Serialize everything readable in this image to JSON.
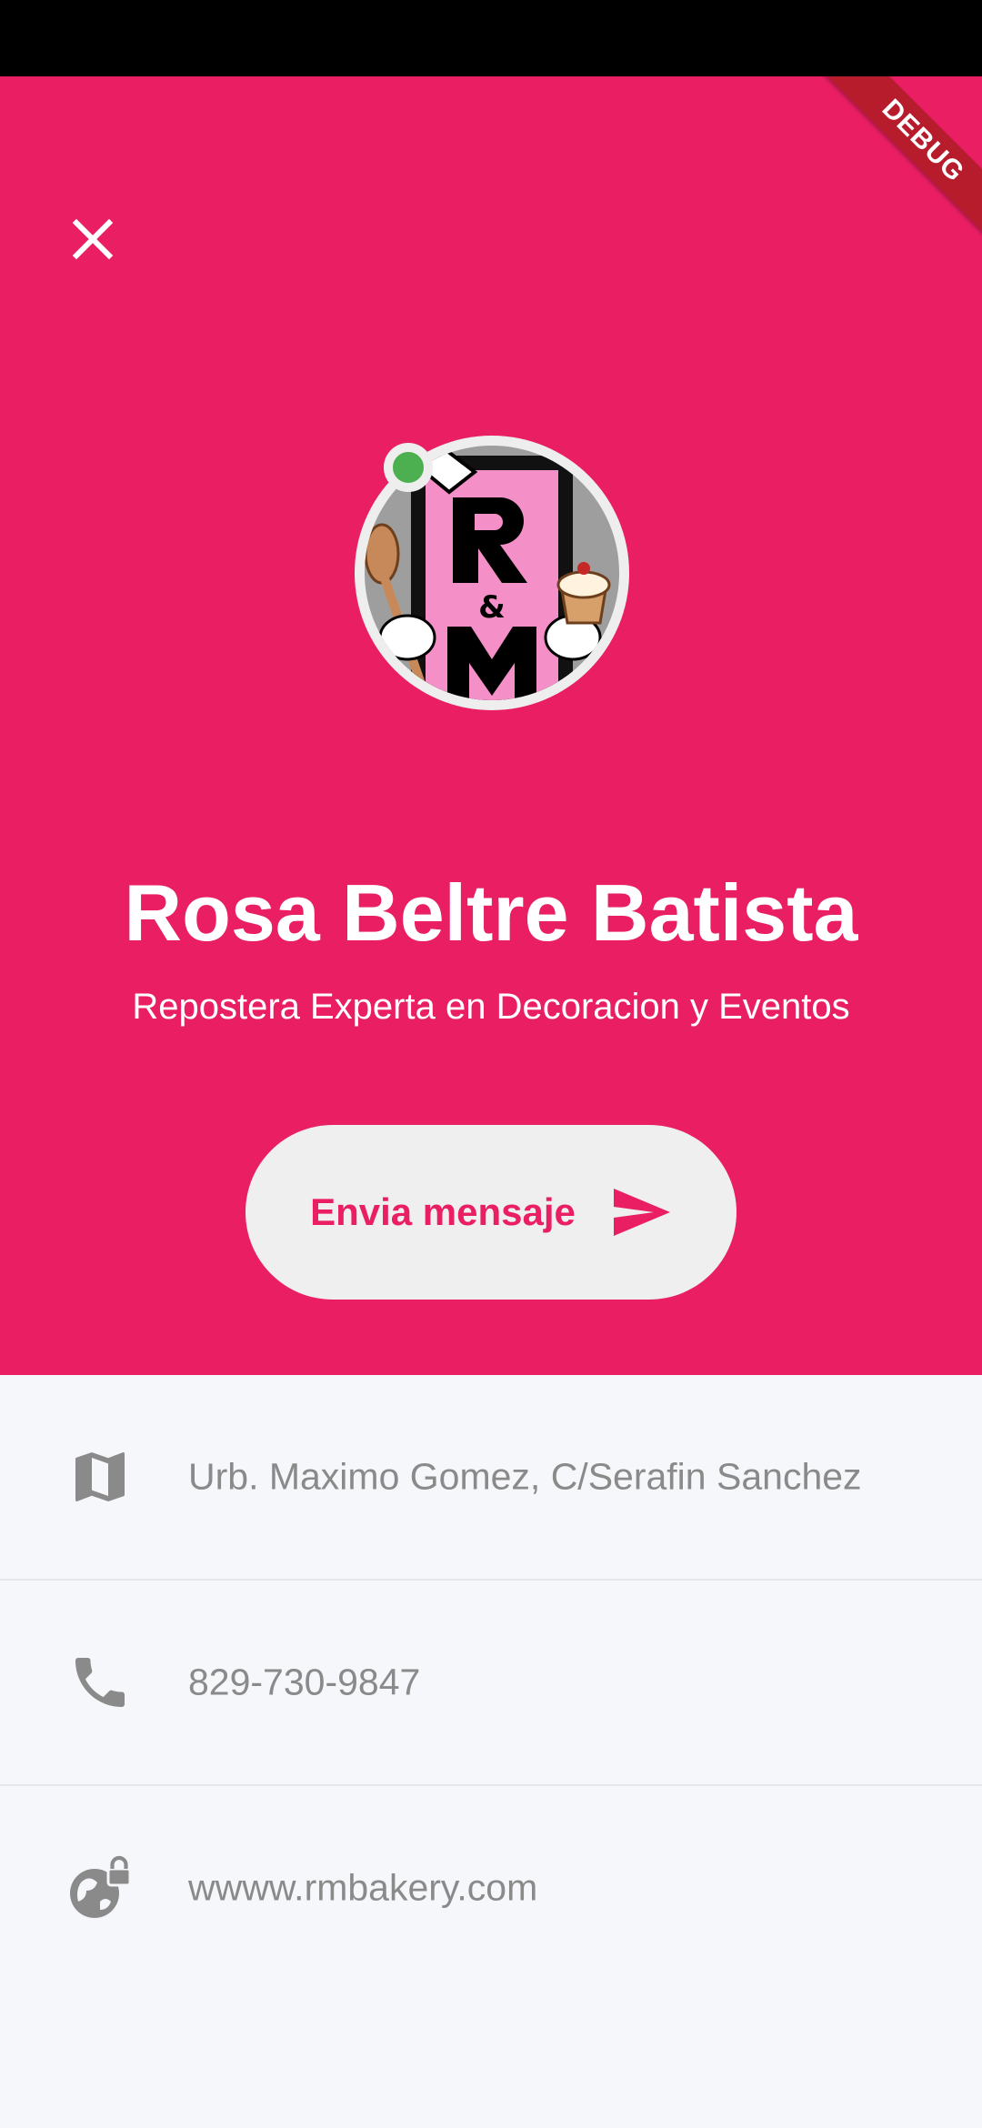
{
  "status_bar": {},
  "debug_banner": {
    "label": "DEBUG"
  },
  "profile": {
    "name": "Rosa Beltre Batista",
    "title": "Repostera Experta en Decoracion y Eventos",
    "avatar_icon": "rm-bakery-logo",
    "online_color": "#4caf50"
  },
  "actions": {
    "message_label": "Envia mensaje",
    "message_icon": "send-icon"
  },
  "contact": {
    "items": [
      {
        "icon": "map-icon",
        "text": "Urb. Maximo Gomez, C/Serafin Sanchez"
      },
      {
        "icon": "phone-icon",
        "text": "829-730-9847"
      },
      {
        "icon": "globe-lock-icon",
        "text": "wwww.rmbakery.com"
      }
    ]
  },
  "colors": {
    "accent": "#e91e63",
    "background": "#f6f7fb",
    "muted_text": "#8a8a8a",
    "button_bg": "#f0efef"
  }
}
